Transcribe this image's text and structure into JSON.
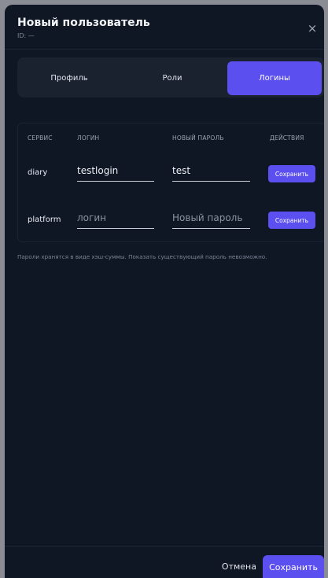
{
  "modal": {
    "title": "Новый пользователь",
    "id_label": "ID: —",
    "close_icon": "×"
  },
  "tabs": [
    {
      "label": "Профиль",
      "active": false
    },
    {
      "label": "Роли",
      "active": false
    },
    {
      "label": "Логины",
      "active": true
    }
  ],
  "table": {
    "headers": [
      "СЕРВИС",
      "ЛОГИН",
      "НОВЫЙ ПАРОЛЬ",
      "ДЕЙСТВИЯ"
    ],
    "rows": [
      {
        "service": "diary",
        "login_value": "testlogin",
        "login_placeholder": "логин",
        "password_value": "test",
        "password_placeholder": "Новый пароль",
        "action_label": "Сохранить"
      },
      {
        "service": "platform",
        "login_value": "",
        "login_placeholder": "логин",
        "password_value": "",
        "password_placeholder": "Новый пароль",
        "action_label": "Сохранить"
      }
    ]
  },
  "hint": "Пароли хранятся в виде хэш-суммы. Показать существующий пароль невозможно.",
  "footer": {
    "cancel_label": "Отмена",
    "save_label": "Сохранить"
  },
  "colors": {
    "accent": "#5b4ff0",
    "background": "#0f1624",
    "panel": "#1a2230"
  }
}
